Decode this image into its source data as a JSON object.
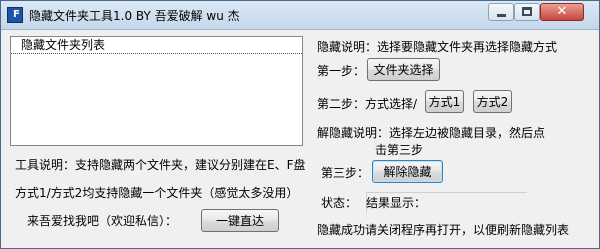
{
  "window": {
    "title": "隐藏文件夹工具1.0 BY 吾爱破解 wu 杰",
    "app_icon_glyph": "F",
    "close_glyph": "✕"
  },
  "list": {
    "header": "隐藏文件夹列表"
  },
  "left": {
    "tool_desc": "工具说明：支持隐藏两个文件夹，建议分别建在E、F盘",
    "method_desc": "方式1/方式2均支持隐藏一个文件夹（感觉太多没用）",
    "contact_label": "来吾爱找我吧（欢迎私信）：",
    "one_click_button": "一键直达"
  },
  "right": {
    "hide_desc": "隐藏说明：选择要隐藏文件夹再选择隐藏方式",
    "step1_label": "第一步：",
    "select_folder_button": "文件夹选择",
    "step2_label": "第二步：方式选择/",
    "method1_button": "方式1",
    "method2_button": "方式2",
    "unhide_desc_line1": "解隐藏说明：选择左边被隐藏目录，然后点",
    "unhide_desc_line2": "击第三步",
    "step3_label": "第三步：",
    "unhide_button": "解除隐藏",
    "status_label": "状态：",
    "result_label": "结果显示：",
    "footer_note": "隐藏成功请关闭程序再打开，以便刷新隐藏列表"
  }
}
